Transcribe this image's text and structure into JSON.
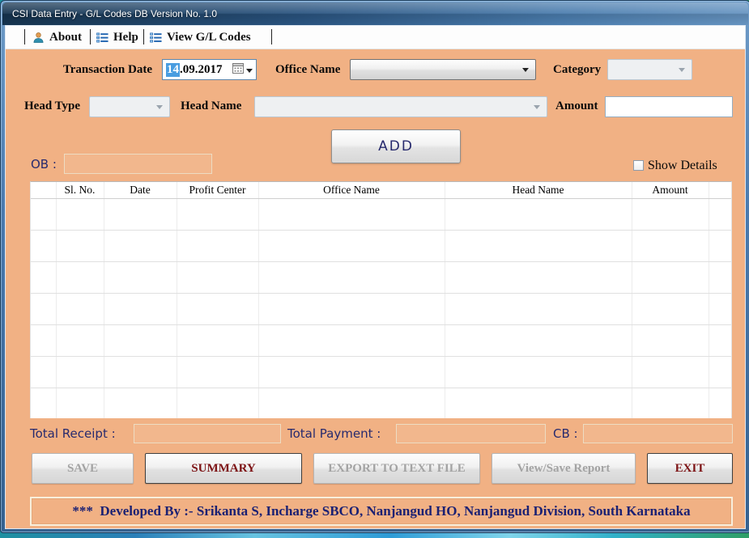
{
  "window": {
    "title": "CSI Data Entry - G/L Codes DB Version No. 1.0"
  },
  "menu": {
    "items": [
      {
        "label": "About",
        "icon": "user-icon"
      },
      {
        "label": "Help",
        "icon": "list-icon"
      },
      {
        "label": "View G/L Codes",
        "icon": "list-icon"
      }
    ]
  },
  "form": {
    "transaction_date": {
      "label": "Transaction Date",
      "value": "14.09.2017",
      "selected": "14",
      "rest": ".09.2017"
    },
    "office_name": {
      "label": "Office Name",
      "value": ""
    },
    "category": {
      "label": "Category",
      "value": ""
    },
    "head_type": {
      "label": "Head Type",
      "value": ""
    },
    "head_name": {
      "label": "Head Name",
      "value": ""
    },
    "amount": {
      "label": "Amount",
      "value": ""
    },
    "add_button_label": "ADD",
    "ob_label": "OB :",
    "ob_value": "",
    "show_details_label": "Show Details",
    "show_details_checked": false
  },
  "table": {
    "columns": [
      "",
      "Sl. No.",
      "Date",
      "Profit Center",
      "Office Name",
      "Head Name",
      "Amount",
      ""
    ],
    "row_count": 7,
    "rows": []
  },
  "totals": {
    "receipt_label": "Total Receipt :",
    "receipt_value": "",
    "payment_label": "Total Payment :",
    "payment_value": "",
    "cb_label": "CB :",
    "cb_value": ""
  },
  "actions": [
    {
      "label": "SAVE",
      "enabled": false
    },
    {
      "label": "SUMMARY",
      "enabled": true
    },
    {
      "label": "EXPORT TO TEXT FILE",
      "enabled": false
    },
    {
      "label": "View/Save Report",
      "enabled": false
    },
    {
      "label": "EXIT",
      "enabled": true
    }
  ],
  "footer": {
    "text": "***  Developed By :- Srikanta S, Incharge SBCO, Nanjangud HO, Nanjangud Division, South Karnataka"
  },
  "colors": {
    "panel_bg": "#f1b184",
    "titlebar_dark": "#1c3f63",
    "titlebar_light": "#6694c1",
    "navy_text": "#272a6e",
    "maroon_text": "#7d1315",
    "selection_blue": "#4a9de0",
    "menu_icon_blue": "#1f63b0"
  }
}
